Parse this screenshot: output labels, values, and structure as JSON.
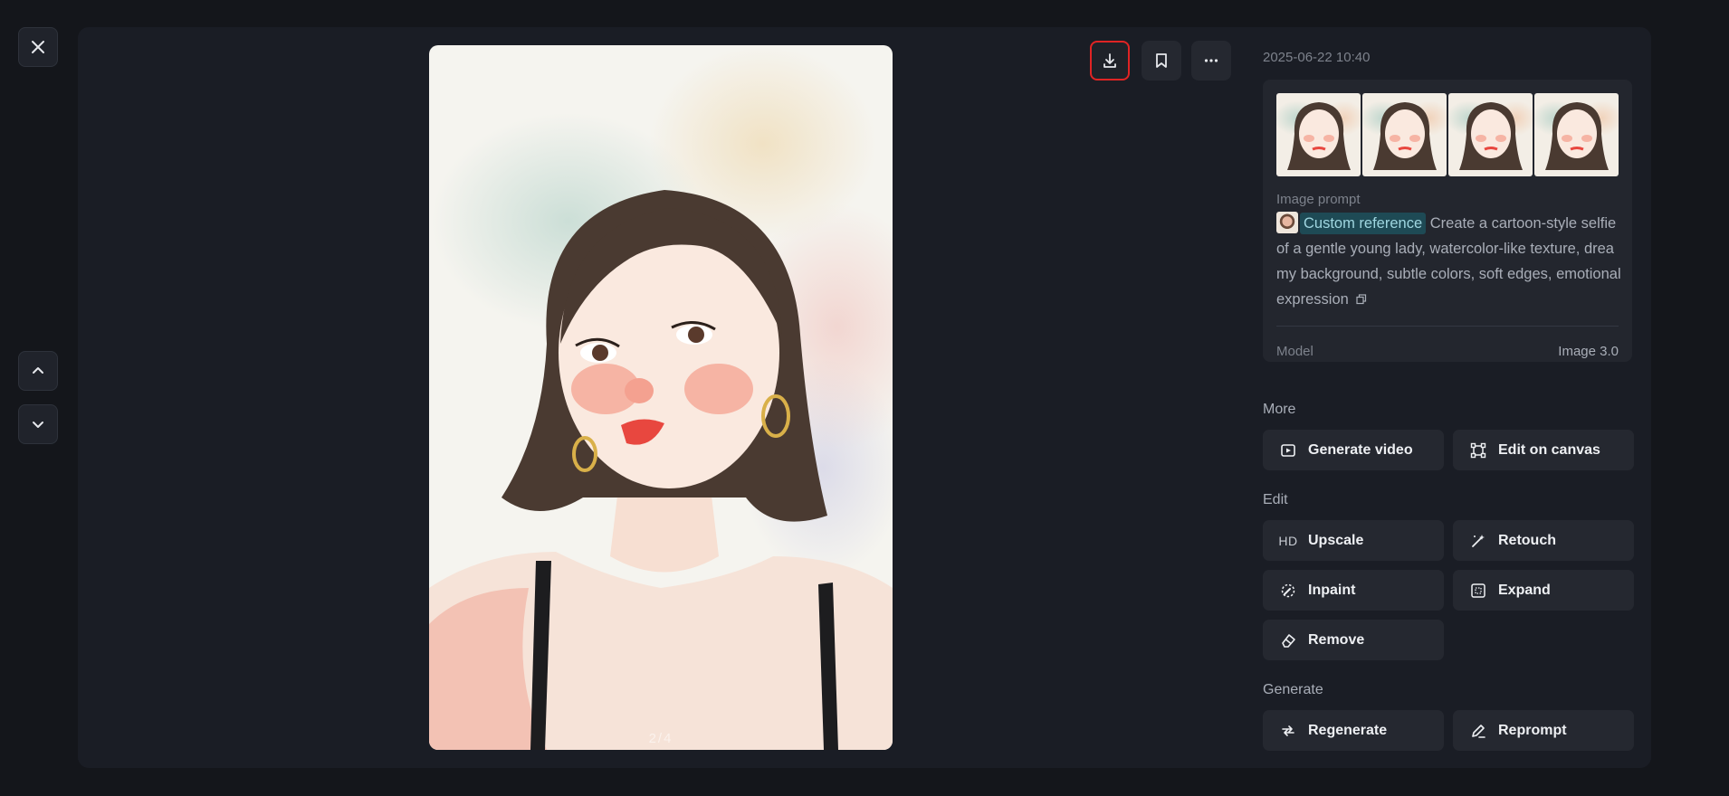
{
  "viewer": {
    "pager": "2/4"
  },
  "details": {
    "date": "2025-06-22 10:40",
    "prompt_label": "Image prompt",
    "reference_chip": "Custom reference",
    "prompt_text": "Create a cartoon-style selfie of a gentle young lady, watercolor-like texture, dreamy background, subtle colors, soft edges, emotional expression",
    "model_label": "Model",
    "model_value": "Image 3.0"
  },
  "sections": {
    "more": "More",
    "edit": "Edit",
    "generate": "Generate"
  },
  "actions": {
    "generate_video": "Generate video",
    "edit_on_canvas": "Edit on canvas",
    "upscale_badge": "HD",
    "upscale": "Upscale",
    "retouch": "Retouch",
    "inpaint": "Inpaint",
    "expand": "Expand",
    "remove": "Remove",
    "regenerate": "Regenerate",
    "reprompt": "Reprompt"
  },
  "icons": {
    "close": "close-icon",
    "prev": "chevron-up-icon",
    "next": "chevron-down-icon",
    "download": "download-icon",
    "bookmark": "bookmark-icon",
    "more": "more-icon",
    "copy": "copy-icon"
  },
  "colors": {
    "background": "#14161b",
    "panel": "#1a1d25",
    "button": "#252830",
    "highlight": "#e02424",
    "chip": "#1e4a55"
  }
}
